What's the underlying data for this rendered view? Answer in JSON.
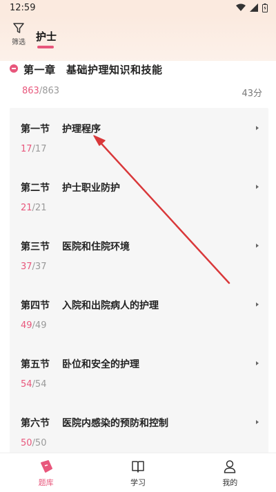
{
  "status_bar": {
    "time": "12:59"
  },
  "header": {
    "filter_label": "筛选",
    "active_tab": "护士"
  },
  "chapter": {
    "title": "第一章　基础护理知识和技能",
    "done": "863",
    "total": "/863",
    "score": "43分"
  },
  "sections": [
    {
      "num": "第一节",
      "name": "护理程序",
      "done": "17",
      "total": "/17"
    },
    {
      "num": "第二节",
      "name": "护士职业防护",
      "done": "21",
      "total": "/21"
    },
    {
      "num": "第三节",
      "name": "医院和住院环境",
      "done": "37",
      "total": "/37"
    },
    {
      "num": "第四节",
      "name": "入院和出院病人的护理",
      "done": "49",
      "total": "/49"
    },
    {
      "num": "第五节",
      "name": "卧位和安全的护理",
      "done": "54",
      "total": "/54"
    },
    {
      "num": "第六节",
      "name": "医院内感染的预防和控制",
      "done": "50",
      "total": "/50"
    }
  ],
  "bottom_nav": [
    {
      "label": "题库",
      "icon": "question-bank-icon",
      "active": true
    },
    {
      "label": "学习",
      "icon": "book-icon",
      "active": false
    },
    {
      "label": "我的",
      "icon": "user-icon",
      "active": false
    }
  ],
  "colors": {
    "accent": "#e8577c",
    "annotation": "#d9383a"
  }
}
